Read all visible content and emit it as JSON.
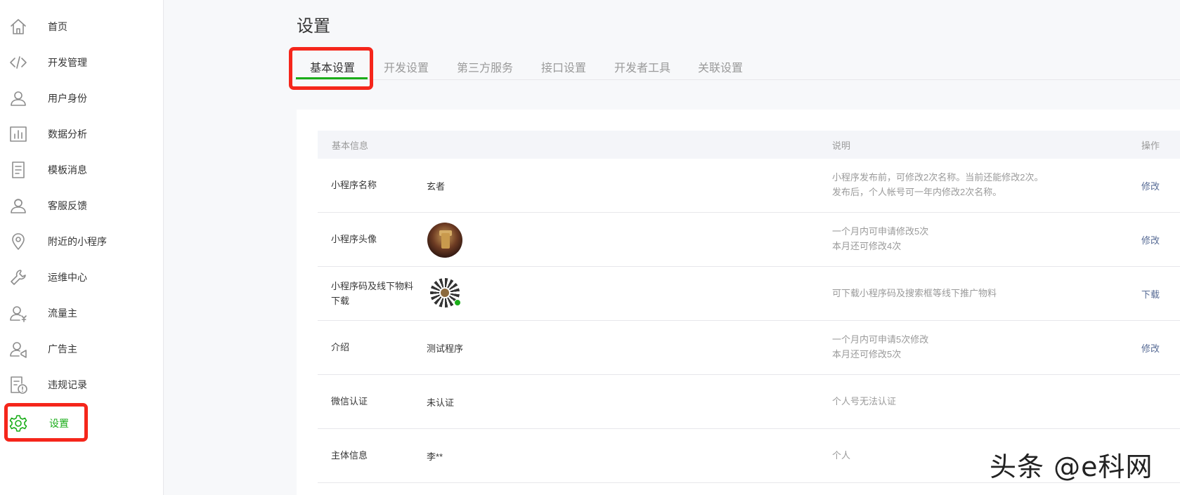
{
  "sidebar": {
    "items": [
      {
        "label": "首页",
        "icon": "home-icon"
      },
      {
        "label": "开发管理",
        "icon": "code-icon"
      },
      {
        "label": "用户身份",
        "icon": "user-icon"
      },
      {
        "label": "数据分析",
        "icon": "bar-chart-icon"
      },
      {
        "label": "模板消息",
        "icon": "document-icon"
      },
      {
        "label": "客服反馈",
        "icon": "customer-service-icon"
      },
      {
        "label": "附近的小程序",
        "icon": "location-pin-icon"
      },
      {
        "label": "运维中心",
        "icon": "wrench-icon"
      },
      {
        "label": "流量主",
        "icon": "user-yen-icon"
      },
      {
        "label": "广告主",
        "icon": "user-megaphone-icon"
      },
      {
        "label": "违规记录",
        "icon": "violation-record-icon"
      },
      {
        "label": "设置",
        "icon": "gear-icon",
        "active": true
      }
    ]
  },
  "page": {
    "title": "设置"
  },
  "tabs": [
    "基本设置",
    "开发设置",
    "第三方服务",
    "接口设置",
    "开发者工具",
    "关联设置"
  ],
  "table": {
    "headers": {
      "info": "基本信息",
      "desc": "说明",
      "action": "操作"
    },
    "rows": [
      {
        "name": "小程序名称",
        "value": "玄者",
        "desc1": "小程序发布前，可修改2次名称。当前还能修改2次。",
        "desc2": "发布后，个人帐号可一年内修改2次名称。",
        "action": "修改"
      },
      {
        "name": "小程序头像",
        "value": "",
        "desc1": "一个月内可申请修改5次",
        "desc2": "本月还可修改4次",
        "action": "修改"
      },
      {
        "name": "小程序码及线下物料下载",
        "value": "",
        "desc1": "可下载小程序码及搜索框等线下推广物料",
        "desc2": "",
        "action": "下载"
      },
      {
        "name": "介绍",
        "value": "测试程序",
        "desc1": "一个月内可申请5次修改",
        "desc2": "本月还可修改5次",
        "action": "修改"
      },
      {
        "name": "微信认证",
        "value": "未认证",
        "desc1": "个人号无法认证",
        "desc2": "",
        "action": ""
      },
      {
        "name": "主体信息",
        "value": "李**",
        "desc1": "个人",
        "desc2": "",
        "action": ""
      }
    ]
  },
  "watermark": "头条 @e科网",
  "colors": {
    "accent": "#1aad19",
    "highlight": "#f5261b",
    "link": "#576b95"
  }
}
